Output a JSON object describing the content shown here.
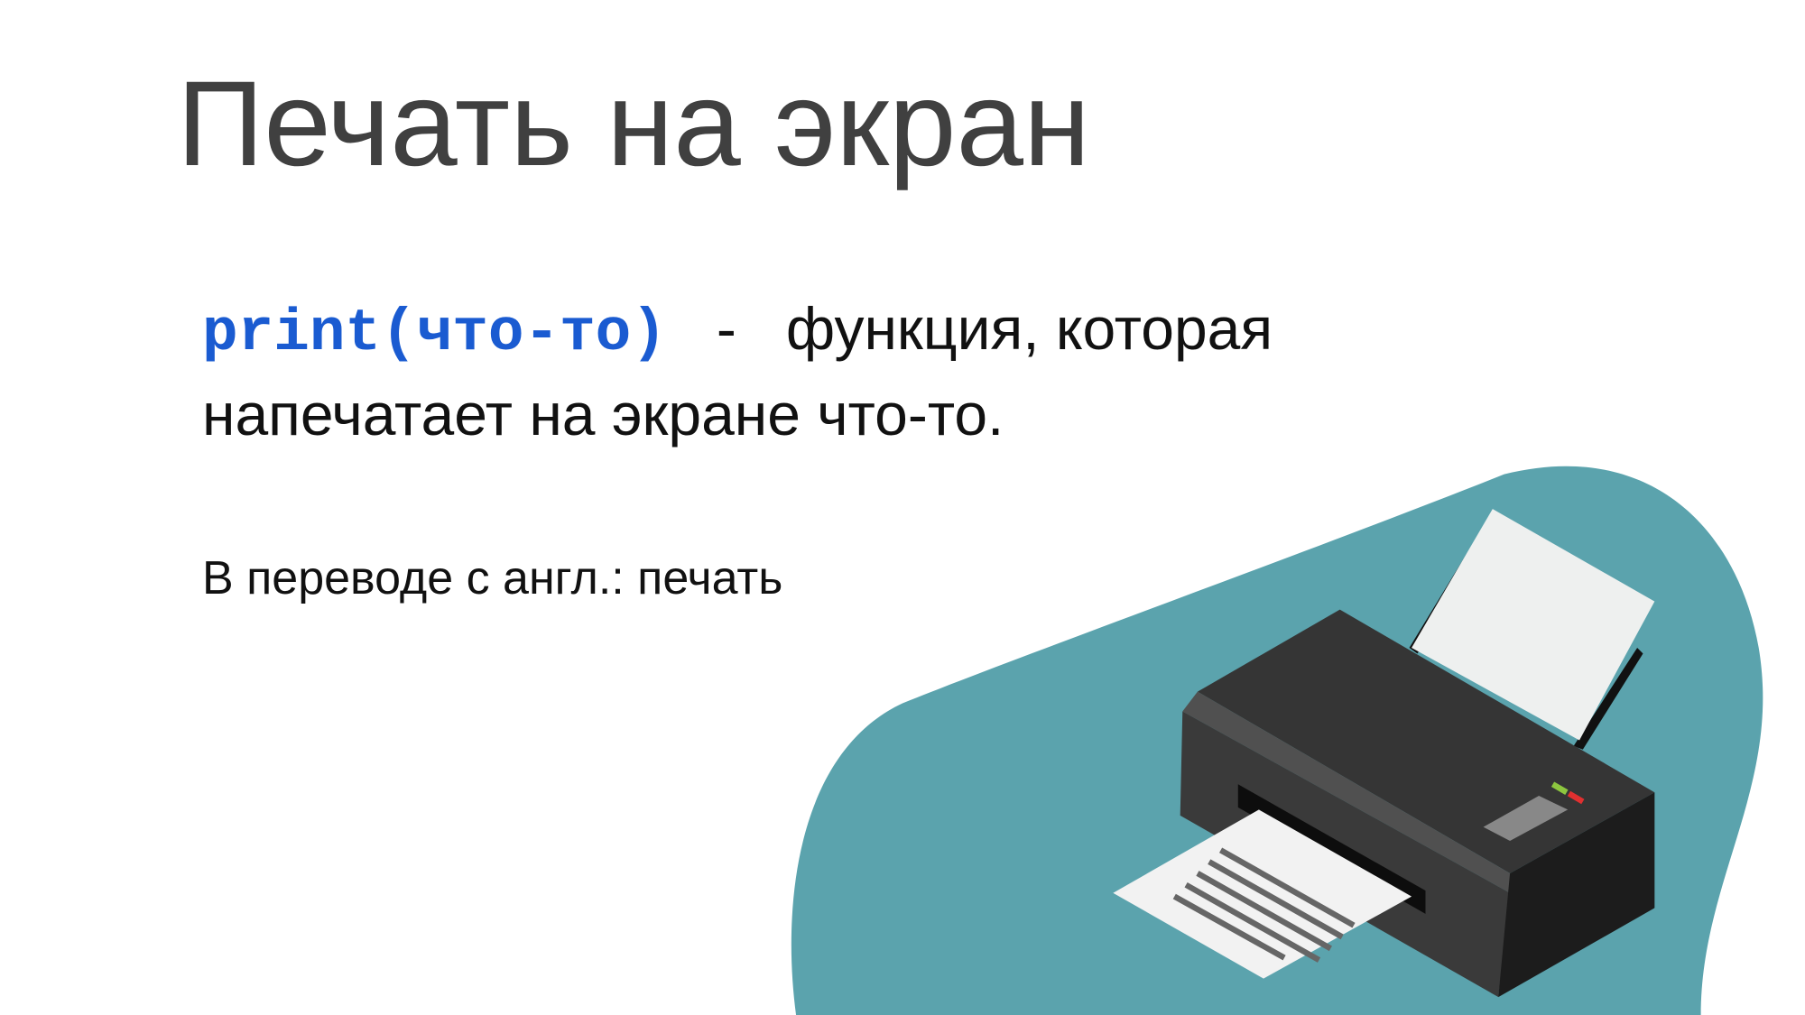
{
  "slide": {
    "title": "Печать на экран",
    "code": "print(что-то)",
    "separator": "-",
    "description_part1": "функция, которая",
    "description_part2": "напечатает на экране что-то.",
    "translation": "В переводе с англ.: печать"
  },
  "colors": {
    "code": "#1a5bd1",
    "blob": "#5ba3ad",
    "title": "#404040"
  },
  "illustration": {
    "icon": "printer-icon"
  }
}
